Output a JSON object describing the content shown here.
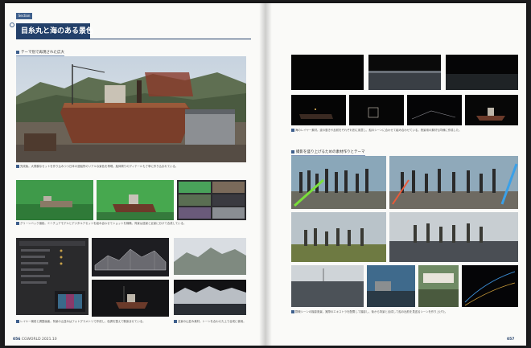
{
  "left_page": {
    "section_tab": "Section",
    "title": "目糸丸と海のある景色",
    "caption_header": "テーマ別で再現された広大",
    "main_caption": "完成版。大規模なセットを作り込みつつ日本の造船所のリアルな景色を再現。船体周りのディテールも丁寧に作り込まれている。",
    "row2_caption": "グリーンバック撮影。ミニチュアモデルとデジタルアセットを組み合わせてショットを構築。背景は遠景と近景に分けて合成している。",
    "row3_left_caption": "レイヤー構成と調整画面。背景の山並みはフォトグラメトリで作成し、色調を整えて馴染ませている。",
    "row3_right_caption": "遠景の山並み素材。トーンを合わせた上で合成に使用。",
    "folio_number": "056",
    "folio_magazine": "CGWORLD 2021.10"
  },
  "right_page": {
    "caption_header": "撮影を盛り上げるための素材作りとテーマ",
    "top_caption": "海のレイヤー素材。波の動きや反射をそれぞれ別に用意し、船のシーンに合わせて組み合わせている。夜景用の素材も同様に作成した。",
    "bottom_caption": "群衆シーンの撮影風景。実際のエキストラを配置して撮影し、後から背景と合成して船の出航を見送るシーンを作り上げた。",
    "folio_number": "057"
  }
}
